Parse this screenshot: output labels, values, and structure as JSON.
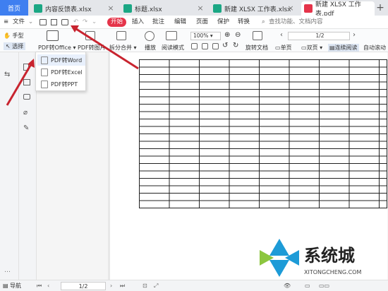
{
  "tabs": {
    "home": "首页",
    "items": [
      {
        "label": "内容反馈表.xlsx",
        "color": "#1ba784"
      },
      {
        "label": "标题.xlsx",
        "color": "#1ba784"
      },
      {
        "label": "新建 XLSX 工作表.xlsx",
        "color": "#1ba784"
      },
      {
        "label": "新建 XLSX 工作表.pdf",
        "color": "#e5344a",
        "active": true
      }
    ]
  },
  "menu": {
    "file": "文件",
    "items": [
      "开始",
      "插入",
      "批注",
      "编辑",
      "页面",
      "保护",
      "转换"
    ],
    "search_placeholder": "查找功能、文档内容"
  },
  "ribbon": {
    "hand": "手型",
    "select": "选择",
    "pdf_office": "PDF转Office",
    "pdf_image": "PDF转图片",
    "split_merge": "拆分合并",
    "play": "播放",
    "read_mode": "阅读模式",
    "zoom": "100%",
    "page": "1/2",
    "rotate": "旋转文档",
    "single": "单页",
    "double": "双页",
    "continuous": "连续阅读",
    "auto_scroll": "自动滚动"
  },
  "dropdown": {
    "items": [
      "PDF转Word",
      "PDF转Excel",
      "PDF转PPT"
    ]
  },
  "status": {
    "nav": "导航",
    "page": "1/2"
  },
  "watermark": {
    "title": "系统城",
    "url": "XITONGCHENG.COM"
  }
}
